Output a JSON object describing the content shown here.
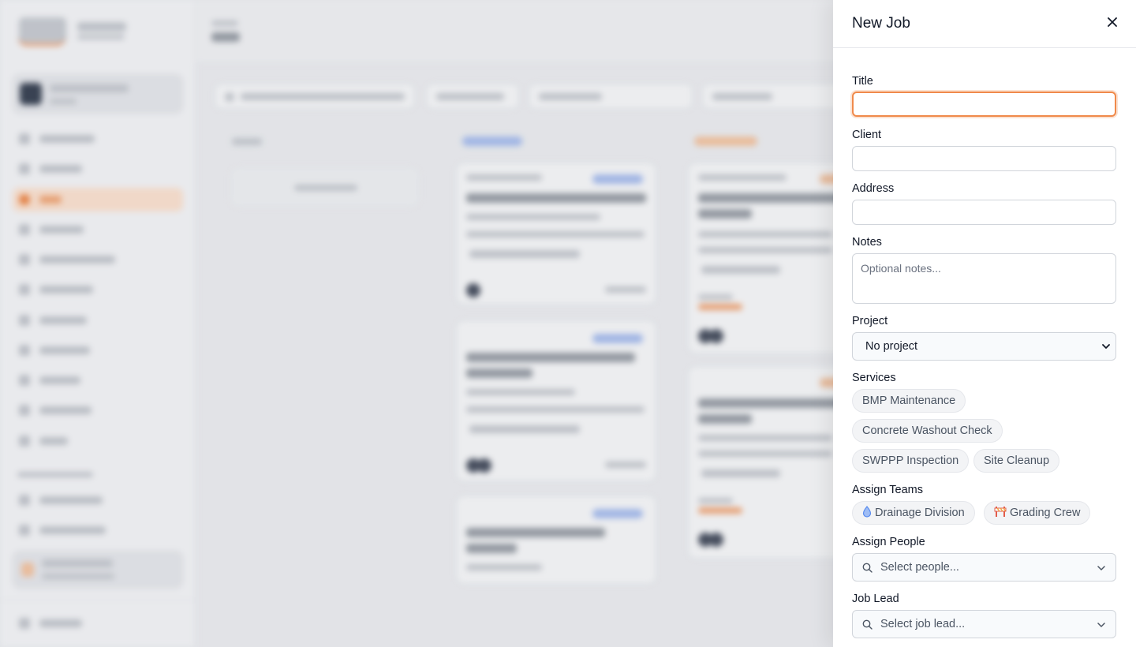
{
  "panel": {
    "title": "New Job",
    "fields": {
      "title_label": "Title",
      "title_value": "",
      "client_label": "Client",
      "client_value": "",
      "address_label": "Address",
      "address_value": "",
      "notes_label": "Notes",
      "notes_placeholder": "Optional notes...",
      "project_label": "Project",
      "project_selected": "No project",
      "services_label": "Services",
      "services": [
        "BMP Maintenance",
        "Concrete Washout Check",
        "SWPPP Inspection",
        "Site Cleanup"
      ],
      "teams_label": "Assign Teams",
      "teams": [
        {
          "name": "Drainage Division",
          "icon": "water-drop-icon"
        },
        {
          "name": "Grading Crew",
          "icon": "construction-barrier-icon"
        }
      ],
      "people_label": "Assign People",
      "people_placeholder": "Select people...",
      "lead_label": "Job Lead",
      "lead_placeholder": "Select job lead..."
    }
  },
  "colors": {
    "accent": "#f08a4b",
    "drop_blue": "#5b8def",
    "barrier_red": "#e25c4b",
    "barrier_orange": "#f2a33a"
  }
}
